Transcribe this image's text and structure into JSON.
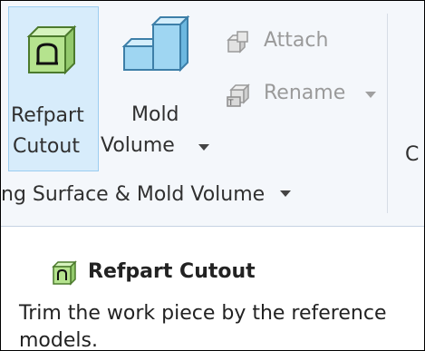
{
  "ribbon": {
    "buttons": [
      {
        "id": "refpart-cutout",
        "line1": "Refpart",
        "line2": "Cutout",
        "icon": "refpart-cutout-icon",
        "active": true
      },
      {
        "id": "mold-volume",
        "line1": "Mold",
        "line2": "Volume",
        "icon": "mold-volume-icon",
        "has_dropdown": true
      }
    ],
    "small_buttons": [
      {
        "id": "attach",
        "label": "Attach",
        "icon": "attach-icon",
        "enabled": false
      },
      {
        "id": "rename",
        "label": "Rename",
        "icon": "rename-icon",
        "enabled": false,
        "has_dropdown": true
      }
    ],
    "cut_off_label": "C",
    "group_label": "ng Surface & Mold Volume"
  },
  "tooltip": {
    "title": "Refpart Cutout",
    "description": "Trim the work piece by the reference models."
  },
  "colors": {
    "active_button_bg": "#d7ecfb",
    "active_button_border": "#9ccdf0",
    "icon_green": "#b5e38e",
    "icon_blue": "#9fd6f2"
  }
}
